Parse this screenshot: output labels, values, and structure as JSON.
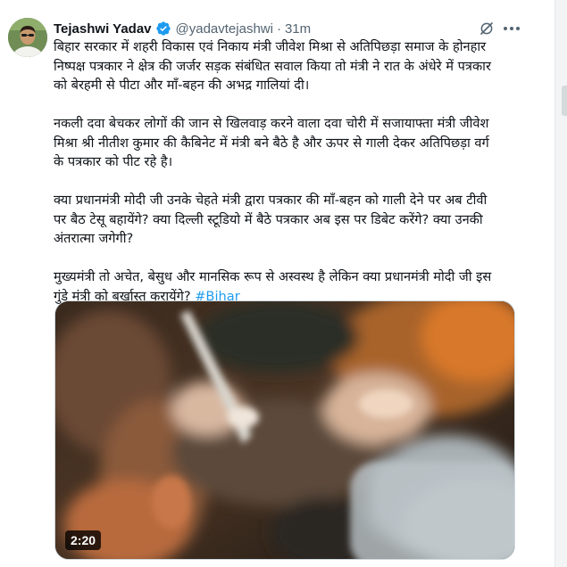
{
  "tweet": {
    "author_name": "Tejashwi Yadav",
    "handle": "@yadavtejashwi",
    "separator": "·",
    "time": "31m",
    "paragraphs": [
      [
        "बिहार सरकार में शहरी विकास एवं निकाय मंत्री जीवेश मिश्रा से अतिपिछड़ा समाज के होनहार",
        "निष्पक्ष पत्रकार ने क्षेत्र की जर्जर सड़क संबंधित सवाल किया तो मंत्री ने रात के अंधेरे में पत्रकार",
        "को बेरहमी से पीटा और माँ-बहन की अभद्र गालियां दी।"
      ],
      [
        "नकली दवा बेचकर लोगों की जान से खिलवाड़ करने वाला दवा चोरी में सजायाफ्ता मंत्री जीवेश",
        "मिश्रा श्री नीतीश कुमार की कैबिनेट में मंत्री बने बैठे है और ऊपर से गाली देकर अतिपिछड़ा वर्ग",
        "के पत्रकार को पीट रहे है।"
      ],
      [
        "क्या प्रधानमंत्री मोदी जी उनके चेहते मंत्री द्वारा पत्रकार की माँ-बहन को गाली देने पर अब टीवी",
        "पर बैठ टेसू बहायेंगे? क्या दिल्ली स्टूडियो में बैठे पत्रकार अब इस पर डिबेट करेंगे? क्या उनकी",
        "अंतरात्मा जगेगी?"
      ],
      [
        "मुख्यमंत्री तो अचेत, बेसुध और मानसिक रूप से अस्वस्थ है लेकिन क्या प्रधानमंत्री मोदी जी इस"
      ]
    ],
    "last_line_text": "गुंडे मंत्री को बर्खास्त करायेंगे? ",
    "hashtag": "#Bihar",
    "video_duration": "2:20"
  },
  "icons": {
    "verified": "verified-badge-icon",
    "grok": "grok-icon",
    "more": "more-options-icon"
  },
  "colors": {
    "verified": "#1d9bf0",
    "hashtag": "#1d9bf0",
    "secondary_text": "#536471"
  }
}
